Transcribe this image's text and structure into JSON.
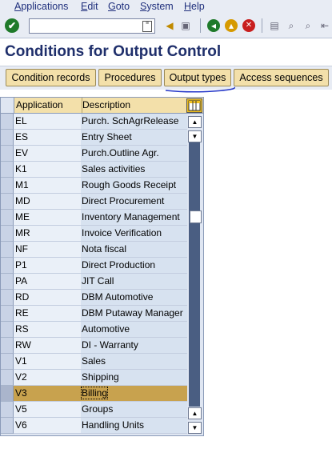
{
  "menu": {
    "items": [
      {
        "first": "A",
        "rest": "pplications"
      },
      {
        "first": "E",
        "rest": "dit"
      },
      {
        "first": "G",
        "rest": "oto"
      },
      {
        "first": "S",
        "rest": "ystem"
      },
      {
        "first": "H",
        "rest": "elp"
      }
    ]
  },
  "toolbar": {
    "command_value": "",
    "check_glyph": "✔"
  },
  "page": {
    "title": "Conditions for Output Control"
  },
  "app_toolbar": {
    "buttons": [
      "Condition records",
      "Procedures",
      "Output types",
      "Access sequences"
    ]
  },
  "table": {
    "headers": {
      "application": "Application",
      "description": "Description"
    },
    "rows": [
      {
        "app": "EL",
        "desc": "Purch. SchAgrRelease"
      },
      {
        "app": "ES",
        "desc": "Entry Sheet"
      },
      {
        "app": "EV",
        "desc": "Purch.Outline Agr."
      },
      {
        "app": "K1",
        "desc": "Sales activities"
      },
      {
        "app": "M1",
        "desc": "Rough Goods Receipt"
      },
      {
        "app": "MD",
        "desc": "Direct Procurement"
      },
      {
        "app": "ME",
        "desc": "Inventory Management"
      },
      {
        "app": "MR",
        "desc": "Invoice Verification"
      },
      {
        "app": "NF",
        "desc": "Nota fiscal"
      },
      {
        "app": "P1",
        "desc": "Direct Production"
      },
      {
        "app": "PA",
        "desc": "JIT Call"
      },
      {
        "app": "RD",
        "desc": "DBM Automotive"
      },
      {
        "app": "RE",
        "desc": "DBM Putaway Manager"
      },
      {
        "app": "RS",
        "desc": "Automotive"
      },
      {
        "app": "RW",
        "desc": "DI - Warranty"
      },
      {
        "app": "V1",
        "desc": "Sales"
      },
      {
        "app": "V2",
        "desc": "Shipping"
      },
      {
        "app": "V3",
        "desc": "Billing"
      },
      {
        "app": "V5",
        "desc": "Groups"
      },
      {
        "app": "V6",
        "desc": "Handling Units"
      }
    ],
    "selected_index": 17
  },
  "colors": {
    "accent": "#c8a24e",
    "title": "#1f2f6b",
    "button_bg": "#f3e0aa",
    "annotation": "#2436c8"
  }
}
